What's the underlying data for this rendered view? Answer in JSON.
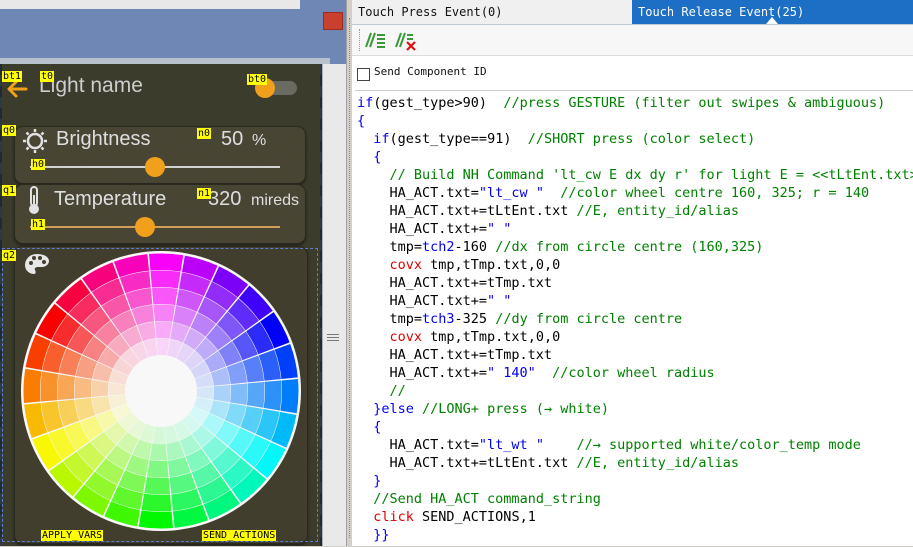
{
  "left": {
    "tags": {
      "bt1": "bt1",
      "t0": "t0",
      "bt0": "bt0",
      "q0": "q0",
      "n0": "n0",
      "h0": "h0",
      "q1": "q1",
      "n1": "n1",
      "h1": "h1",
      "q2": "q2",
      "apply": "APPLY_VARS",
      "send": "SEND_ACTIONS"
    },
    "light_name": "Light name",
    "brightness_label": "Brightness",
    "brightness_value": "50",
    "brightness_unit": "%",
    "brightness_level": 0.5,
    "temperature_label": "Temperature",
    "temperature_value": "320",
    "temperature_unit": "mireds",
    "temperature_level": 0.46,
    "toggle_on": false,
    "icons": {
      "back": "arrow-left-icon",
      "brightness": "sun-icon",
      "temperature": "thermometer-icon",
      "palette": "palette-icon"
    }
  },
  "tabs": {
    "press": "Touch Press Event(0)",
    "release": "Touch Release Event(25)"
  },
  "toolbar": {
    "icons": [
      "comment-lines-icon",
      "uncomment-lines-icon"
    ]
  },
  "send_component_id": "Send Component ID",
  "code_lines": [
    [
      [
        "k",
        "if"
      ],
      [
        "n",
        "(gest_type>90)  "
      ],
      [
        "c",
        "//press GESTURE (filter out swipes & ambiguous)"
      ]
    ],
    [
      [
        "k",
        "{"
      ]
    ],
    [
      [
        "n",
        "  "
      ],
      [
        "k",
        "if"
      ],
      [
        "n",
        "(gest_type==91)  "
      ],
      [
        "c",
        "//SHORT press (color select)"
      ]
    ],
    [
      [
        "n",
        "  "
      ],
      [
        "k",
        "{"
      ]
    ],
    [
      [
        "n",
        "    "
      ],
      [
        "c",
        "// Build NH Command 'lt_cw E dx dy r' for light E = <<tLtEnt.txt>>"
      ]
    ],
    [
      [
        "n",
        "    HA_ACT.txt="
      ],
      [
        "s",
        "\"lt_cw \""
      ],
      [
        "n",
        "  "
      ],
      [
        "c",
        "//color wheel centre 160, 325; r = 140"
      ]
    ],
    [
      [
        "n",
        "    HA_ACT.txt+=tLtEnt.txt "
      ],
      [
        "c",
        "//E, entity_id/alias"
      ]
    ],
    [
      [
        "n",
        "    HA_ACT.txt+="
      ],
      [
        "s",
        "\" \""
      ]
    ],
    [
      [
        "n",
        "    tmp="
      ],
      [
        "s",
        "tch2"
      ],
      [
        "n",
        "-160 "
      ],
      [
        "c",
        "//dx from circle centre (160,325)"
      ]
    ],
    [
      [
        "n",
        "    "
      ],
      [
        "r",
        "covx"
      ],
      [
        "n",
        " tmp,tTmp.txt,0,0"
      ]
    ],
    [
      [
        "n",
        "    HA_ACT.txt+=tTmp.txt"
      ]
    ],
    [
      [
        "n",
        "    HA_ACT.txt+="
      ],
      [
        "s",
        "\" \""
      ]
    ],
    [
      [
        "n",
        "    tmp="
      ],
      [
        "s",
        "tch3"
      ],
      [
        "n",
        "-325 "
      ],
      [
        "c",
        "//dy from circle centre"
      ]
    ],
    [
      [
        "n",
        "    "
      ],
      [
        "r",
        "covx"
      ],
      [
        "n",
        " tmp,tTmp.txt,0,0"
      ]
    ],
    [
      [
        "n",
        "    HA_ACT.txt+=tTmp.txt"
      ]
    ],
    [
      [
        "n",
        "    HA_ACT.txt+="
      ],
      [
        "s",
        "\" 140\""
      ],
      [
        "n",
        "  "
      ],
      [
        "c",
        "//color wheel radius"
      ]
    ],
    [
      [
        "n",
        "    "
      ],
      [
        "c",
        "//"
      ]
    ],
    [
      [
        "n",
        "  "
      ],
      [
        "k",
        "}else"
      ],
      [
        "n",
        " "
      ],
      [
        "c",
        "//LONG+ press (→ white)"
      ]
    ],
    [
      [
        "n",
        "  "
      ],
      [
        "k",
        "{"
      ]
    ],
    [
      [
        "n",
        "    HA_ACT.txt="
      ],
      [
        "s",
        "\"lt_wt \""
      ],
      [
        "n",
        "    "
      ],
      [
        "c",
        "//→ supported white/color_temp mode"
      ]
    ],
    [
      [
        "n",
        "    HA_ACT.txt+=tLtEnt.txt "
      ],
      [
        "c",
        "//E, entity_id/alias"
      ]
    ],
    [
      [
        "n",
        "  "
      ],
      [
        "k",
        "}"
      ]
    ],
    [
      [
        "n",
        "  "
      ],
      [
        "c",
        "//Send HA_ACT command_string"
      ]
    ],
    [
      [
        "n",
        "  "
      ],
      [
        "r",
        "click"
      ],
      [
        "n",
        " SEND_ACTIONS,1"
      ]
    ],
    [
      [
        "n",
        "  "
      ],
      [
        "k",
        "}}"
      ]
    ]
  ],
  "colors": {
    "accent_tab": "#1c6fc4",
    "slider_orange": "#f7a41a",
    "tag_yellow": "#ffff00",
    "keyword": "#0000ee",
    "comment": "#008000",
    "builtin": "#e00000"
  }
}
